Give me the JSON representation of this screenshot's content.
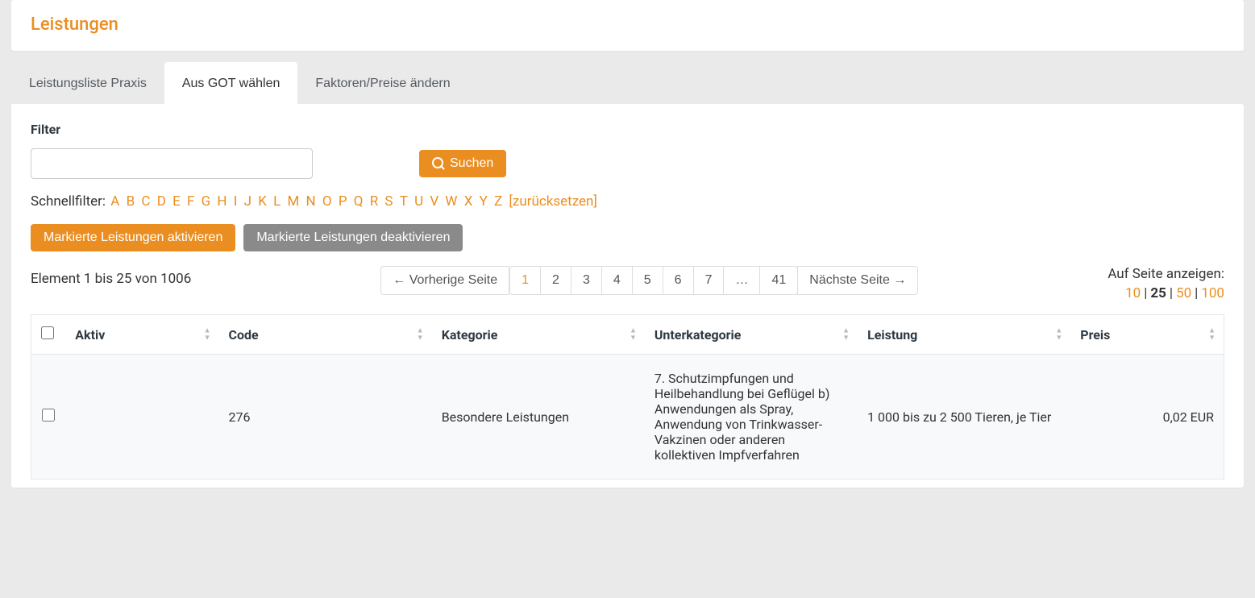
{
  "page": {
    "title": "Leistungen"
  },
  "tabs": [
    {
      "label": "Leistungsliste Praxis",
      "active": false
    },
    {
      "label": "Aus GOT wählen",
      "active": true
    },
    {
      "label": "Faktoren/Preise ändern",
      "active": false
    }
  ],
  "filter": {
    "label": "Filter",
    "value": "",
    "search_button": "Suchen"
  },
  "quickfilter": {
    "label": "Schnellfilter:",
    "letters": [
      "A",
      "B",
      "C",
      "D",
      "E",
      "F",
      "G",
      "H",
      "I",
      "J",
      "K",
      "L",
      "M",
      "N",
      "O",
      "P",
      "Q",
      "R",
      "S",
      "T",
      "U",
      "V",
      "W",
      "X",
      "Y",
      "Z"
    ],
    "reset": "[zurücksetzen]"
  },
  "actions": {
    "activate": "Markierte Leistungen aktivieren",
    "deactivate": "Markierte Leistungen deaktivieren"
  },
  "listing": {
    "summary": "Element 1 bis 25 von 1006",
    "prev": "← Vorherige Seite",
    "next": "Nächste Seite →",
    "pages": [
      "1",
      "2",
      "3",
      "4",
      "5",
      "6",
      "7",
      "…",
      "41"
    ],
    "current_page": "1",
    "page_size_label": "Auf Seite anzeigen:",
    "page_sizes": [
      "10",
      "25",
      "50",
      "100"
    ],
    "current_page_size": "25"
  },
  "table": {
    "headers": {
      "aktiv": "Aktiv",
      "code": "Code",
      "kategorie": "Kategorie",
      "unterkategorie": "Unterkategorie",
      "leistung": "Leistung",
      "preis": "Preis"
    },
    "rows": [
      {
        "aktiv": "",
        "code": "276",
        "kategorie": "Besondere Leistungen",
        "unterkategorie": "7. Schutzimpfungen und Heilbehandlung bei Geflügel b) Anwendungen als Spray, Anwendung von Trinkwasser-Vakzinen oder anderen kollektiven Impfverfahren",
        "leistung": "1 000 bis zu 2 500 Tieren, je Tier",
        "preis": "0,02 EUR"
      }
    ]
  }
}
